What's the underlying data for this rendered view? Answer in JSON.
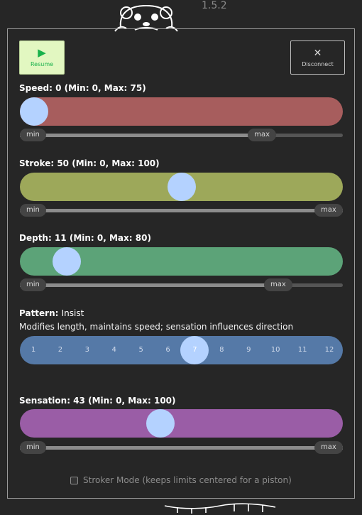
{
  "version": "1.5.2",
  "buttons": {
    "resume_label": "Resume",
    "resume_icon": "play-icon",
    "disconnect_label": "Disconnect",
    "disconnect_icon": "close-icon"
  },
  "speed": {
    "label": "Speed: 0",
    "range_text": "(Min: 0, Max: 75)",
    "value": 0,
    "min": 0,
    "max": 100,
    "limit_min_label": "min",
    "limit_max_label": "max",
    "limit_min": 0,
    "limit_max": 0.75,
    "color": "#a75d5d"
  },
  "stroke": {
    "label": "Stroke: 50",
    "range_text": "(Min: 0, Max: 100)",
    "value": 50,
    "min": 0,
    "max": 100,
    "limit_min_label": "min",
    "limit_max_label": "max",
    "limit_min": 0,
    "limit_max": 1.0,
    "color": "#9da85a"
  },
  "depth": {
    "label": "Depth: 11",
    "range_text": "(Min: 0, Max: 80)",
    "value": 11,
    "min": 0,
    "max": 100,
    "limit_min_label": "min",
    "limit_max_label": "max",
    "limit_min": 0,
    "limit_max": 0.8,
    "color": "#5ca378"
  },
  "pattern": {
    "label": "Pattern:",
    "name": "Insist",
    "description": "Modifies length, maintains speed; sensation influences direction",
    "ticks": [
      "1",
      "2",
      "3",
      "4",
      "5",
      "6",
      "7",
      "8",
      "9",
      "10",
      "11",
      "12"
    ],
    "selected": 7,
    "color": "#5579a7"
  },
  "sensation": {
    "label": "Sensation: 43",
    "range_text": "(Min: 0, Max: 100)",
    "value": 43,
    "min": 0,
    "max": 100,
    "limit_min_label": "min",
    "limit_max_label": "max",
    "limit_min": 0,
    "limit_max": 1.0,
    "color": "#9a5da6"
  },
  "stroker_mode": {
    "label": "Stroker Mode (keeps limits centered for a piston)",
    "checked": false
  },
  "thumb_color": "#b4d2ff"
}
